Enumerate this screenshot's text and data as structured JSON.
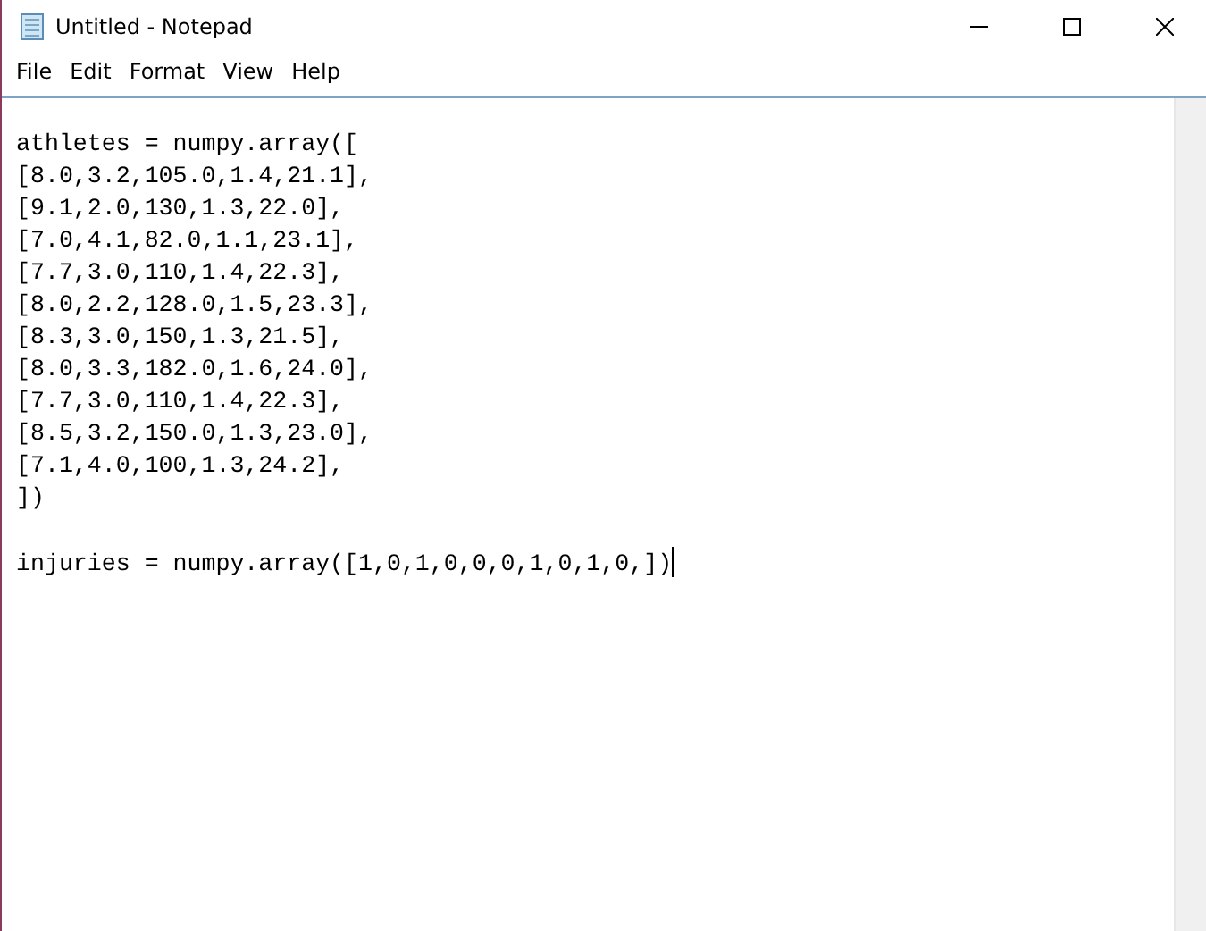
{
  "window": {
    "title": "Untitled - Notepad"
  },
  "menu": [
    "File",
    "Edit",
    "Format",
    "View",
    "Help"
  ],
  "editor": {
    "blocks": [
      [
        "athletes = numpy.array([",
        "[8.0,3.2,105.0,1.4,21.1],",
        "[9.1,2.0,130,1.3,22.0],",
        "[7.0,4.1,82.0,1.1,23.1],",
        "[7.7,3.0,110,1.4,22.3],",
        "[8.0,2.2,128.0,1.5,23.3],",
        "[8.3,3.0,150,1.3,21.5],",
        "[8.0,3.3,182.0,1.6,24.0],",
        "[7.7,3.0,110,1.4,22.3],",
        "[8.5,3.2,150.0,1.3,23.0],",
        "[7.1,4.0,100,1.3,24.2],",
        "])"
      ],
      [
        "injuries = numpy.array([1,0,1,0,0,0,1,0,1,0,])"
      ]
    ]
  }
}
